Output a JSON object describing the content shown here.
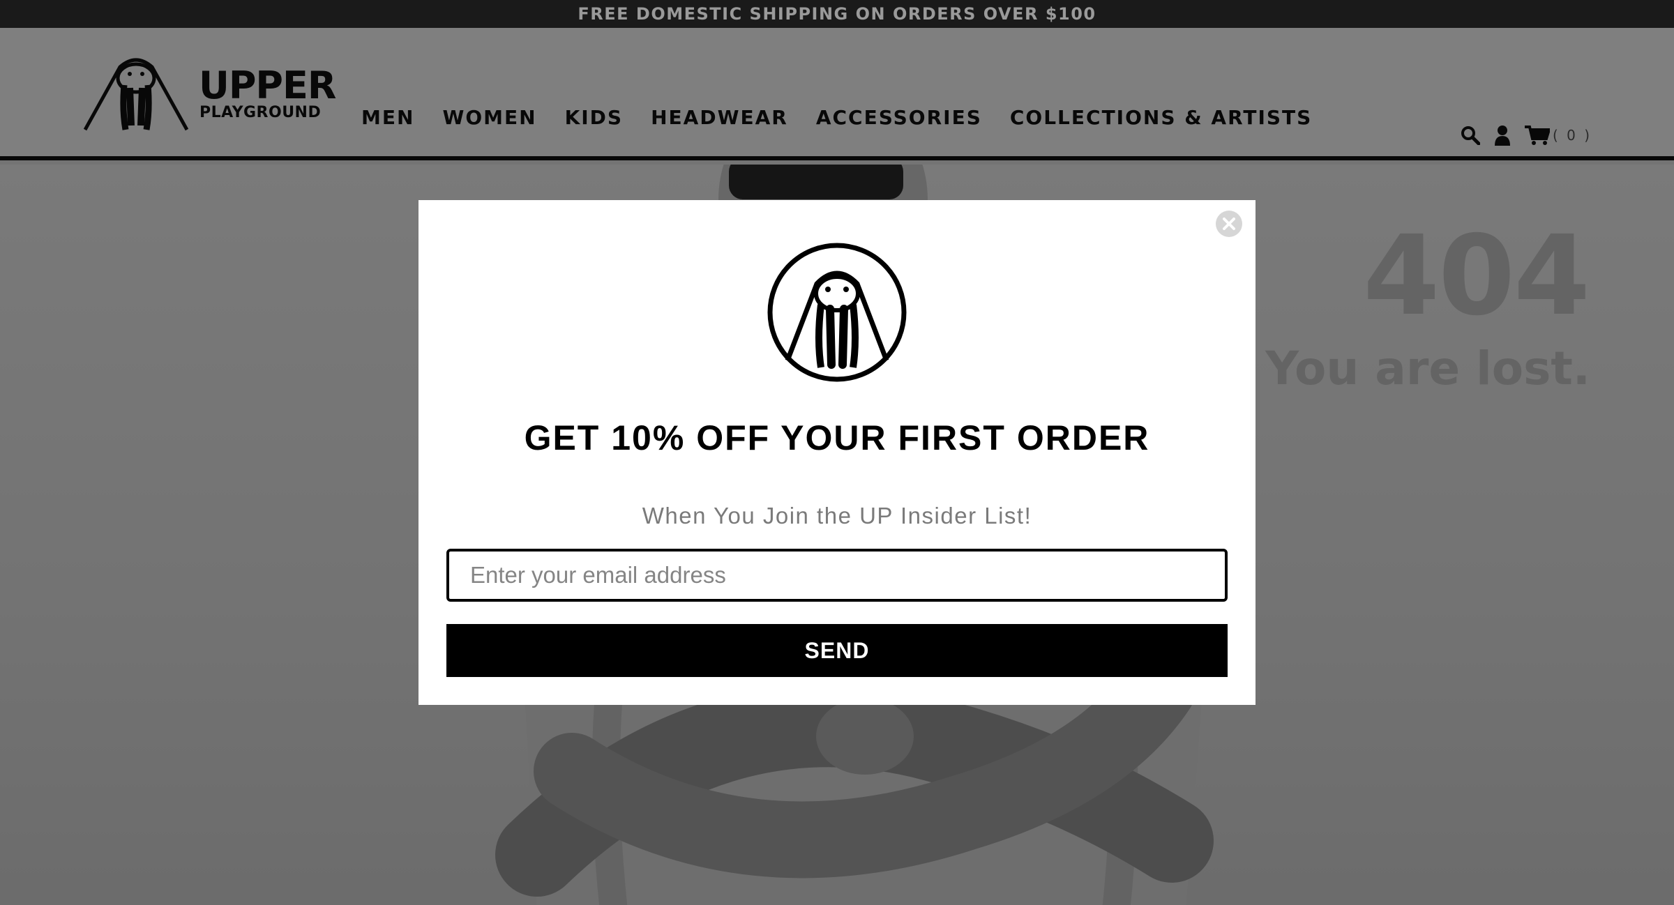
{
  "announcement": "FREE DOMESTIC SHIPPING ON ORDERS OVER $100",
  "brand": {
    "name_line1": "UPPER",
    "name_line2": "PLAYGROUND"
  },
  "nav": [
    {
      "label": "MEN"
    },
    {
      "label": "WOMEN"
    },
    {
      "label": "KIDS"
    },
    {
      "label": "HEADWEAR"
    },
    {
      "label": "ACCESSORIES"
    },
    {
      "label": "COLLECTIONS & ARTISTS"
    }
  ],
  "header_icons": {
    "search": "search-icon",
    "account": "user-icon",
    "cart": "cart-icon",
    "cart_count": "( 0 )"
  },
  "error": {
    "code": "404",
    "message": "You are lost."
  },
  "popup": {
    "title": "GET 10% OFF YOUR FIRST ORDER",
    "subtitle": "When You Join the UP Insider List!",
    "email_placeholder": "Enter your email address",
    "email_value": "",
    "button": "SEND",
    "close_icon": "close-icon"
  },
  "colors": {
    "announcement_bg": "#1a1a1a",
    "announcement_text": "#9a9a9a",
    "overlay": "rgba(0,0,0,0.5)",
    "button_bg": "#000000",
    "button_text": "#ffffff"
  }
}
